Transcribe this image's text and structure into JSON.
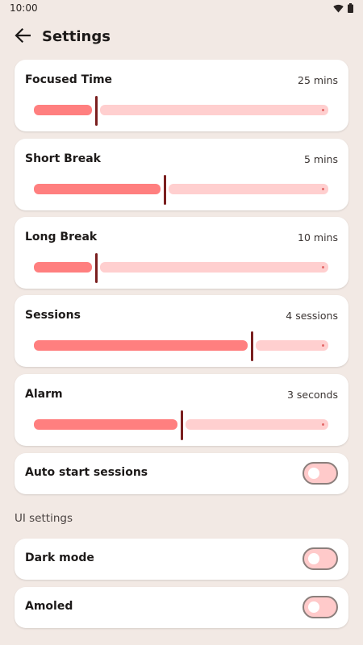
{
  "status_bar": {
    "time": "10:00",
    "icons": [
      "wifi-icon",
      "battery-icon"
    ]
  },
  "app_bar": {
    "title": "Settings",
    "back_icon": "arrow-left-icon"
  },
  "sliders": [
    {
      "label": "Focused Time",
      "value": "25 mins",
      "fraction": 0.21
    },
    {
      "label": "Short Break",
      "value": "5 mins",
      "fraction": 0.445
    },
    {
      "label": "Long Break",
      "value": "10 mins",
      "fraction": 0.21
    },
    {
      "label": "Sessions",
      "value": "4 sessions",
      "fraction": 0.74
    },
    {
      "label": "Alarm",
      "value": "3 seconds",
      "fraction": 0.5
    }
  ],
  "toggles_main": [
    {
      "label": "Auto start sessions",
      "on": false
    }
  ],
  "ui_settings": {
    "header": "UI settings",
    "toggles": [
      {
        "label": "Dark mode",
        "on": false
      },
      {
        "label": "Amoled",
        "on": false
      }
    ]
  },
  "colors": {
    "background": "#F2E9E4",
    "track_active": "#FF7F7F",
    "track_inactive": "#FFCFCF",
    "thumb": "#7A1F1F",
    "switch_track": "#FFCACA"
  }
}
